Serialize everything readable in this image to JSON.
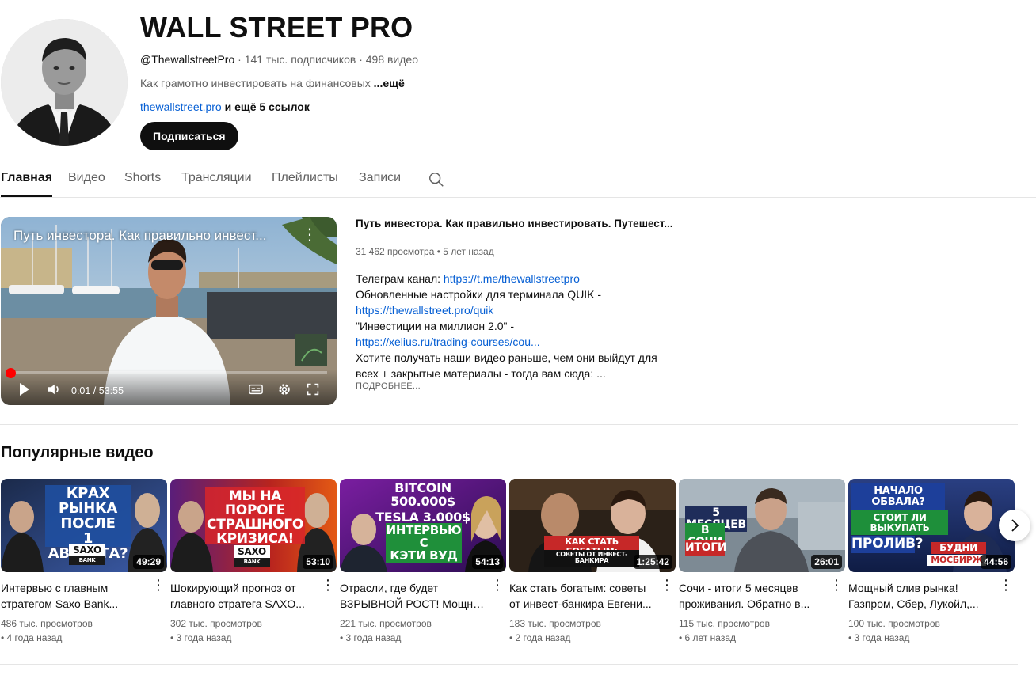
{
  "channel": {
    "name": "WALL STREET PRO",
    "handle": "@ThewallstreetPro",
    "stats": " · 141 тыс. подписчиков · 498 видео",
    "description": "Как грамотно инвестировать на финансовых ",
    "description_more": "...ещё",
    "link": "thewallstreet.pro",
    "links_more": " и ещё 5 ссылок",
    "subscribe_label": "Подписаться"
  },
  "tabs": [
    {
      "label": "Главная",
      "active": true
    },
    {
      "label": "Видео"
    },
    {
      "label": "Shorts"
    },
    {
      "label": "Трансляции"
    },
    {
      "label": "Плейлисты"
    },
    {
      "label": "Записи"
    }
  ],
  "featured": {
    "overlay_title": "Путь инвестора. Как правильно инвест...",
    "title": "Путь инвестора. Как правильно инвестировать. Путешест...",
    "views": "31 462 просмотра",
    "age": "5 лет назад",
    "time": "0:01 / 53:55",
    "progress": 0.0003,
    "desc_1_text": "Телеграм канал: ",
    "desc_1_link": "https://t.me/thewallstreetpro",
    "desc_2": "Обновленные настройки для терминала QUIK -",
    "desc_3_link": "https://thewallstreet.pro/quik",
    "desc_4": "\"Инвестиции на миллион 2.0\" -",
    "desc_5_link": "https://xelius.ru/trading-courses/cou...",
    "desc_6": "Хотите получать наши видео раньше, чем они выйдут для",
    "desc_7": "всех + закрытые материалы - тогда вам сюда: ...",
    "more_label": "ПОДРОБНЕЕ...",
    "watermark": "WALL STREET"
  },
  "popular": {
    "title": "Популярные видео",
    "videos": [
      {
        "title_1": "Интервью с главным",
        "title_2": "стратегом Saxo Bank...",
        "views": "486 тыс. просмотров",
        "age": "• 4 года назад",
        "duration": "49:29",
        "thumb_text": [
          "КРАХ РЫНКА",
          "ПОСЛЕ",
          "1 АВГУСТА?"
        ],
        "badge": "SAXO",
        "badge_sub": "BANK"
      },
      {
        "title_1": "Шокирующий прогноз от",
        "title_2": "главного стратега SAXO...",
        "views": "302 тыс. просмотров",
        "age": "• 3 года назад",
        "duration": "53:10",
        "thumb_text": [
          "МЫ НА ПОРОГЕ",
          "СТРАШНОГО",
          "КРИЗИСА!"
        ],
        "badge": "SAXO",
        "badge_sub": "BANK"
      },
      {
        "title_1": "Отрасли, где будет",
        "title_2": "ВЗРЫВНОЙ РОСТ! Мощны...",
        "views": "221 тыс. просмотров",
        "age": "• 3 года назад",
        "duration": "54:13",
        "thumb_text": [
          "BITCOIN 500.000$",
          "TESLA 3.000$",
          "ИНТЕРВЬЮ С",
          "КЭТИ ВУД"
        ]
      },
      {
        "title_1": "Как стать богатым: советы",
        "title_2": "от инвест-банкира Евгени...",
        "views": "183 тыс. просмотров",
        "age": "• 2 года назад",
        "duration": "1:25:42",
        "thumb_text": [
          "КАК СТАТЬ БОГАТЫМ:",
          "СОВЕТЫ ОТ ИНВЕСТ-БАНКИРА"
        ]
      },
      {
        "title_1": "Сочи - итоги 5 месяцев",
        "title_2": "проживания. Обратно в...",
        "views": "115 тыс. просмотров",
        "age": "• 6 лет назад",
        "duration": "26:01",
        "thumb_text": [
          "5 МЕСЯЦЕВ",
          "В СОЧИ",
          "ИТОГИ"
        ]
      },
      {
        "title_1": "Мощный слив рынка!",
        "title_2": "Газпром, Сбер, Лукойл,...",
        "views": "100 тыс. просмотров",
        "age": "• 3 года назад",
        "duration": "44:56",
        "thumb_text": [
          "НАЧАЛО ОБВАЛА?",
          "СТОИТ ЛИ ВЫКУПАТЬ",
          "ПРОЛИВ?",
          "БУДНИ",
          "МОСБИРЖ"
        ]
      }
    ]
  },
  "icons": {
    "search": "search-icon",
    "play": "play-icon",
    "volume": "volume-icon",
    "subtitles": "subtitles-icon",
    "settings": "gear-icon",
    "fullscreen": "fullscreen-icon",
    "more": "kebab-icon",
    "next": "chevron-right-icon"
  },
  "colors": {
    "accent_red": "#ff0000",
    "link_blue": "#065fd4",
    "text_primary": "#0f0f0f",
    "text_secondary": "#606060"
  }
}
